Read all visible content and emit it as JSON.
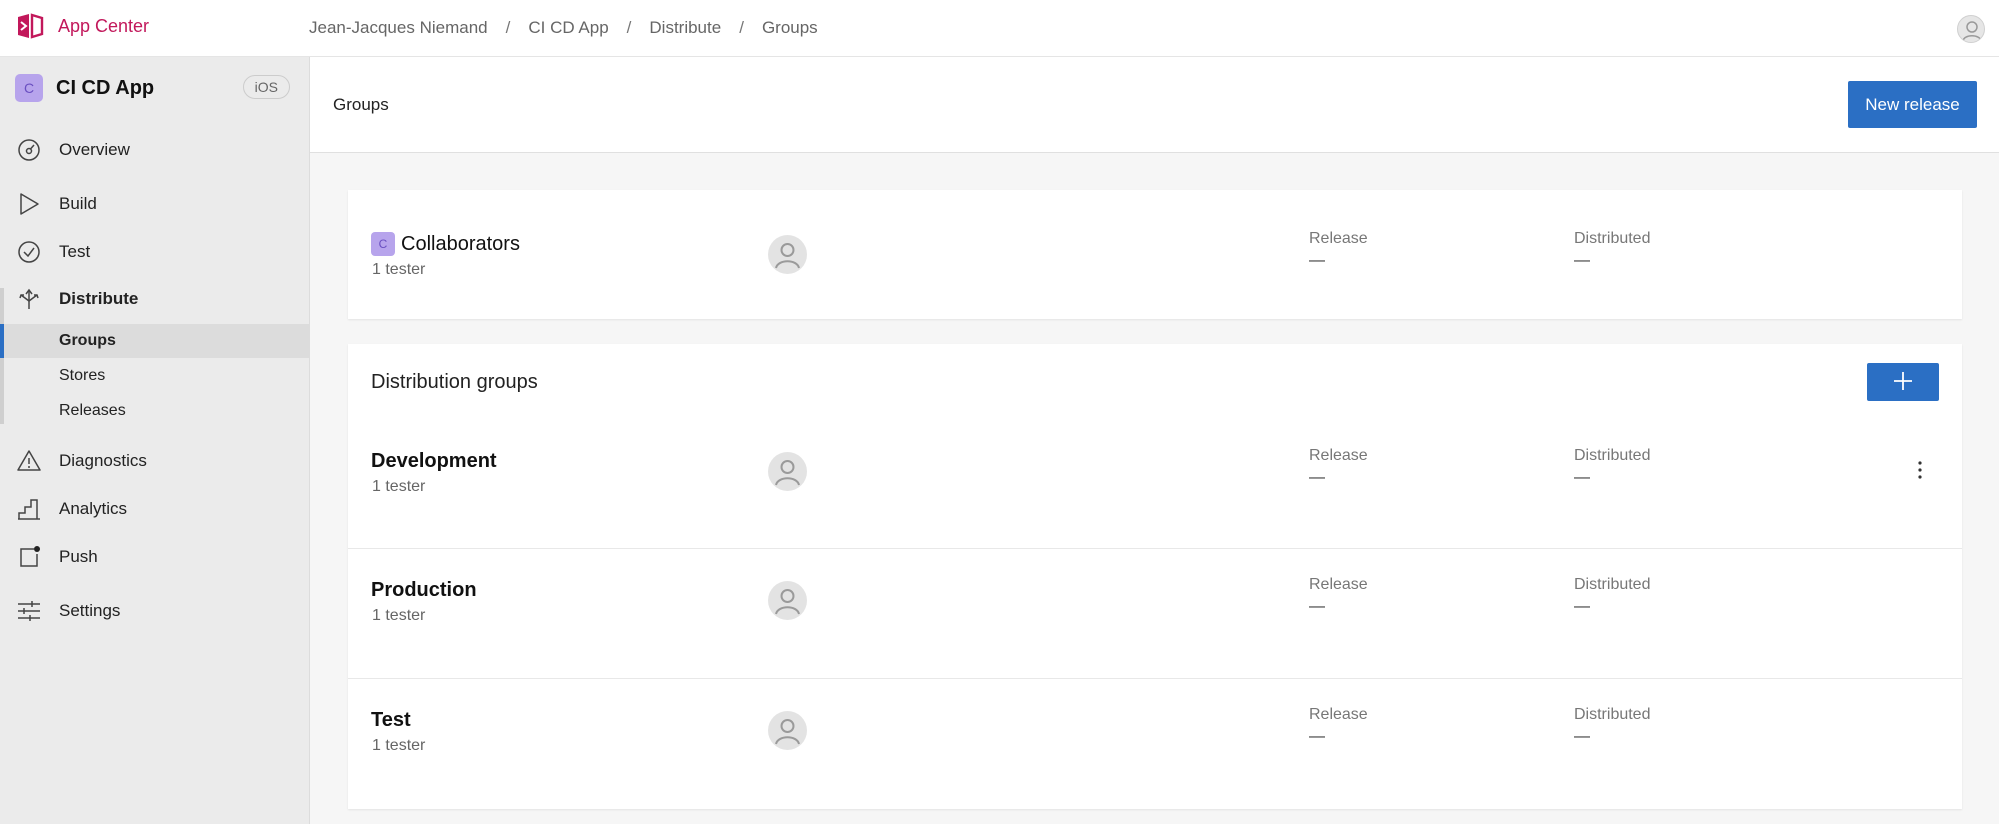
{
  "brand": {
    "name": "App Center"
  },
  "breadcrumb": [
    "Jean-Jacques Niemand",
    "CI CD App",
    "Distribute",
    "Groups"
  ],
  "app": {
    "initial": "C",
    "name": "CI CD App",
    "platform": "iOS"
  },
  "nav": {
    "overview": "Overview",
    "build": "Build",
    "test": "Test",
    "distribute": "Distribute",
    "groups": "Groups",
    "stores": "Stores",
    "releases": "Releases",
    "diagnostics": "Diagnostics",
    "analytics": "Analytics",
    "push": "Push",
    "settings": "Settings"
  },
  "page": {
    "title": "Groups",
    "new_release_label": "New release"
  },
  "collaborators": {
    "initial": "C",
    "name": "Collaborators",
    "testers": "1 tester",
    "release_label": "Release",
    "release_value": "—",
    "distributed_label": "Distributed",
    "distributed_value": "—"
  },
  "distribution": {
    "title": "Distribution groups",
    "groups": [
      {
        "name": "Development",
        "testers": "1 tester",
        "release_label": "Release",
        "release_value": "—",
        "distributed_label": "Distributed",
        "distributed_value": "—"
      },
      {
        "name": "Production",
        "testers": "1 tester",
        "release_label": "Release",
        "release_value": "—",
        "distributed_label": "Distributed",
        "distributed_value": "—"
      },
      {
        "name": "Test",
        "testers": "1 tester",
        "release_label": "Release",
        "release_value": "—",
        "distributed_label": "Distributed",
        "distributed_value": "—"
      }
    ]
  },
  "colors": {
    "accent": "#2b6fc4",
    "brand": "#c2185b",
    "app_icon": "#b7a4ec"
  },
  "icons": [
    "app-center-logo-icon",
    "user-avatar-icon",
    "overview-gauge-icon",
    "build-play-icon",
    "test-check-icon",
    "distribute-arrows-icon",
    "diagnostics-warning-icon",
    "analytics-bars-icon",
    "push-notification-icon",
    "settings-sliders-icon",
    "plus-icon",
    "more-vertical-icon"
  ]
}
